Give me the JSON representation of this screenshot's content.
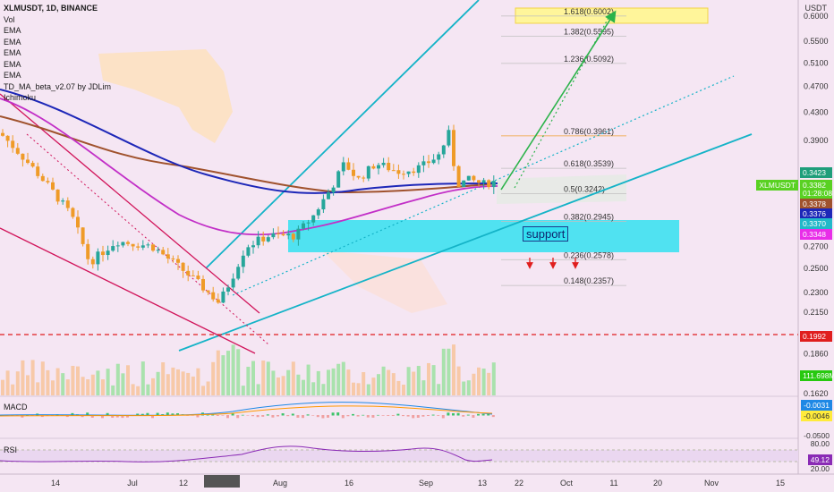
{
  "header": {
    "title": "XLMUSDT, 1D, BINANCE",
    "indicators": [
      "Vol",
      "EMA",
      "EMA",
      "EMA",
      "EMA",
      "EMA",
      "TD_MA_beta_v2.07 by JDLim",
      "Ichimoku"
    ]
  },
  "colors": {
    "background": "#f5e6f3",
    "up": "#26a69a",
    "down": "#ef9b28",
    "ema_blue": "#1d27b8",
    "ema_magenta": "#c22fc7",
    "ema_brown": "#a0522d",
    "channel": "#14b3c7",
    "arrow": "#2bb34a",
    "support_zone": "#33e0f0",
    "support_line": "#e01e1e"
  },
  "chart_data": {
    "type": "candlestick",
    "symbol": "XLMUSDT",
    "timeframe": "1D",
    "exchange": "BINANCE",
    "currency": "USDT",
    "x_ticks": [
      "14",
      "Jul",
      "12",
      "20 Jul '21",
      "Aug",
      "16",
      "Sep",
      "13",
      "22",
      "Oct",
      "11",
      "20",
      "Nov",
      "15"
    ],
    "y_ticks": [
      "0.6000",
      "0.5500",
      "0.5100",
      "0.4700",
      "0.4300",
      "0.3900",
      "0.3423",
      "0.3382",
      "0.3378",
      "0.3376",
      "0.3370",
      "0.3348",
      "0.2700",
      "0.2500",
      "0.2300",
      "0.2150",
      "0.1992",
      "0.1860",
      "0.1620"
    ],
    "ylim": [
      0.16,
      0.62
    ],
    "y_scale": "log",
    "last_price": 0.3382,
    "countdown": "01:28:08",
    "price_tags": [
      {
        "value": "0.3423",
        "color": "#1f9e7a"
      },
      {
        "value": "0.3382",
        "color": "#59d122",
        "label": "XLMUSDT"
      },
      {
        "value": "01:28:08",
        "color": "#59d122"
      },
      {
        "value": "0.3378",
        "color": "#a0522d"
      },
      {
        "value": "0.3376",
        "color": "#1d27b8"
      },
      {
        "value": "0.3370",
        "color": "#22b8c9"
      },
      {
        "value": "0.3348",
        "color": "#e82ee8"
      },
      {
        "value": "0.1992",
        "color": "#e01e1e"
      },
      {
        "value": "111.698M",
        "color": "#27c90f"
      }
    ],
    "fib_levels": [
      {
        "label": "1.618(0.6002)",
        "value": 0.6002
      },
      {
        "label": "1.382(0.5595)",
        "value": 0.5595
      },
      {
        "label": "1.236(0.5092)",
        "value": 0.5092
      },
      {
        "label": "0.786(0.3961)",
        "value": 0.3961
      },
      {
        "label": "0.618(0.3539)",
        "value": 0.3539
      },
      {
        "label": "0.5(0.3242)",
        "value": 0.3242
      },
      {
        "label": "0.382(0.2945)",
        "value": 0.2945
      },
      {
        "label": "0.236(0.2578)",
        "value": 0.2578
      },
      {
        "label": "0.148(0.2357)",
        "value": 0.2357
      }
    ],
    "support_level": 0.1992,
    "annotation": "support",
    "volume_last": "111.698M"
  },
  "macd": {
    "label": "MACD",
    "values": [
      "-0.0031",
      "-0.0046"
    ],
    "ticks": [
      "-0.0500"
    ]
  },
  "rsi": {
    "label": "RSI",
    "value": "49.12",
    "ticks": [
      "80.00",
      "20.00"
    ]
  }
}
